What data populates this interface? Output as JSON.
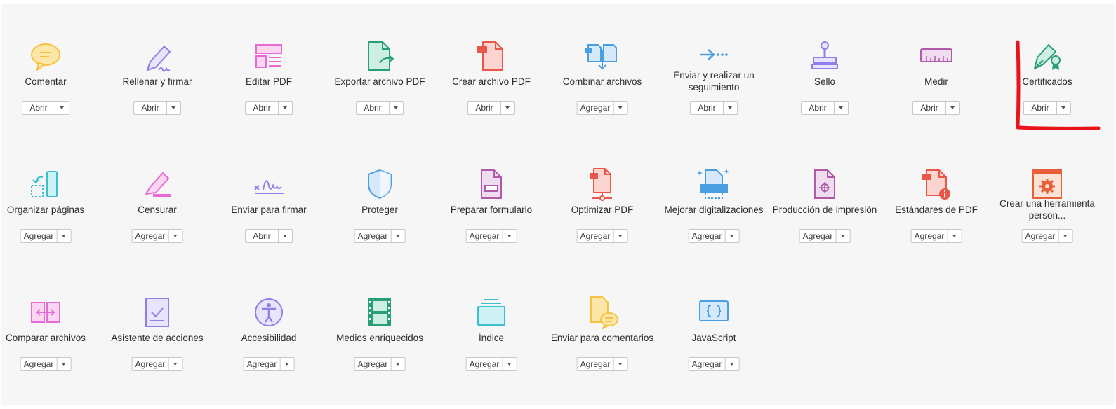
{
  "tools": [
    {
      "name": "Comentar",
      "button": "Abrir",
      "icon": "comment-icon"
    },
    {
      "name": "Rellenar y firmar",
      "button": "Abrir",
      "icon": "fill-sign-icon"
    },
    {
      "name": "Editar PDF",
      "button": "Abrir",
      "icon": "edit-pdf-icon"
    },
    {
      "name": "Exportar archivo PDF",
      "button": "Abrir",
      "icon": "export-pdf-icon"
    },
    {
      "name": "Crear archivo PDF",
      "button": "Abrir",
      "icon": "create-pdf-icon"
    },
    {
      "name": "Combinar archivos",
      "button": "Agregar",
      "icon": "combine-files-icon"
    },
    {
      "name": "Enviar y realizar un seguimiento",
      "button": "Abrir",
      "icon": "send-track-icon"
    },
    {
      "name": "Sello",
      "button": "Abrir",
      "icon": "stamp-icon"
    },
    {
      "name": "Medir",
      "button": "Abrir",
      "icon": "ruler-icon"
    },
    {
      "name": "Certificados",
      "button": "Abrir",
      "icon": "certificate-pen-icon"
    },
    {
      "name": "Organizar páginas",
      "button": "Agregar",
      "icon": "organize-pages-icon"
    },
    {
      "name": "Censurar",
      "button": "Agregar",
      "icon": "redact-icon"
    },
    {
      "name": "Enviar para firmar",
      "button": "Abrir",
      "icon": "signature-icon"
    },
    {
      "name": "Proteger",
      "button": "Agregar",
      "icon": "shield-icon"
    },
    {
      "name": "Preparar formulario",
      "button": "Agregar",
      "icon": "prepare-form-icon"
    },
    {
      "name": "Optimizar PDF",
      "button": "Agregar",
      "icon": "optimize-pdf-icon"
    },
    {
      "name": "Mejorar digitalizaciones",
      "button": "Agregar",
      "icon": "enhance-scan-icon"
    },
    {
      "name": "Producción de impresión",
      "button": "Agregar",
      "icon": "print-production-icon"
    },
    {
      "name": "Estándares de PDF",
      "button": "Agregar",
      "icon": "pdf-standards-icon"
    },
    {
      "name": "Crear una herramienta person...",
      "button": "Agregar",
      "icon": "custom-tool-gear-icon"
    },
    {
      "name": "Comparar archivos",
      "button": "Agregar",
      "icon": "compare-files-icon"
    },
    {
      "name": "Asistente de acciones",
      "button": "Agregar",
      "icon": "action-wizard-icon"
    },
    {
      "name": "Accesibilidad",
      "button": "Agregar",
      "icon": "accessibility-icon"
    },
    {
      "name": "Medios enriquecidos",
      "button": "Agregar",
      "icon": "film-icon"
    },
    {
      "name": "Índice",
      "button": "Agregar",
      "icon": "index-icon"
    },
    {
      "name": "Enviar para comentarios",
      "button": "Agregar",
      "icon": "send-comments-icon"
    },
    {
      "name": "JavaScript",
      "button": "Agregar",
      "icon": "javascript-braces-icon"
    }
  ],
  "colors": {
    "comment": "#f5c242",
    "purple": "#8f7fe8",
    "pink": "#e86ad6",
    "green": "#2a9d7a",
    "red": "#e8574a",
    "blue": "#4a9fe0",
    "teal": "#3bbfcf",
    "annotation": "#e8141b"
  }
}
